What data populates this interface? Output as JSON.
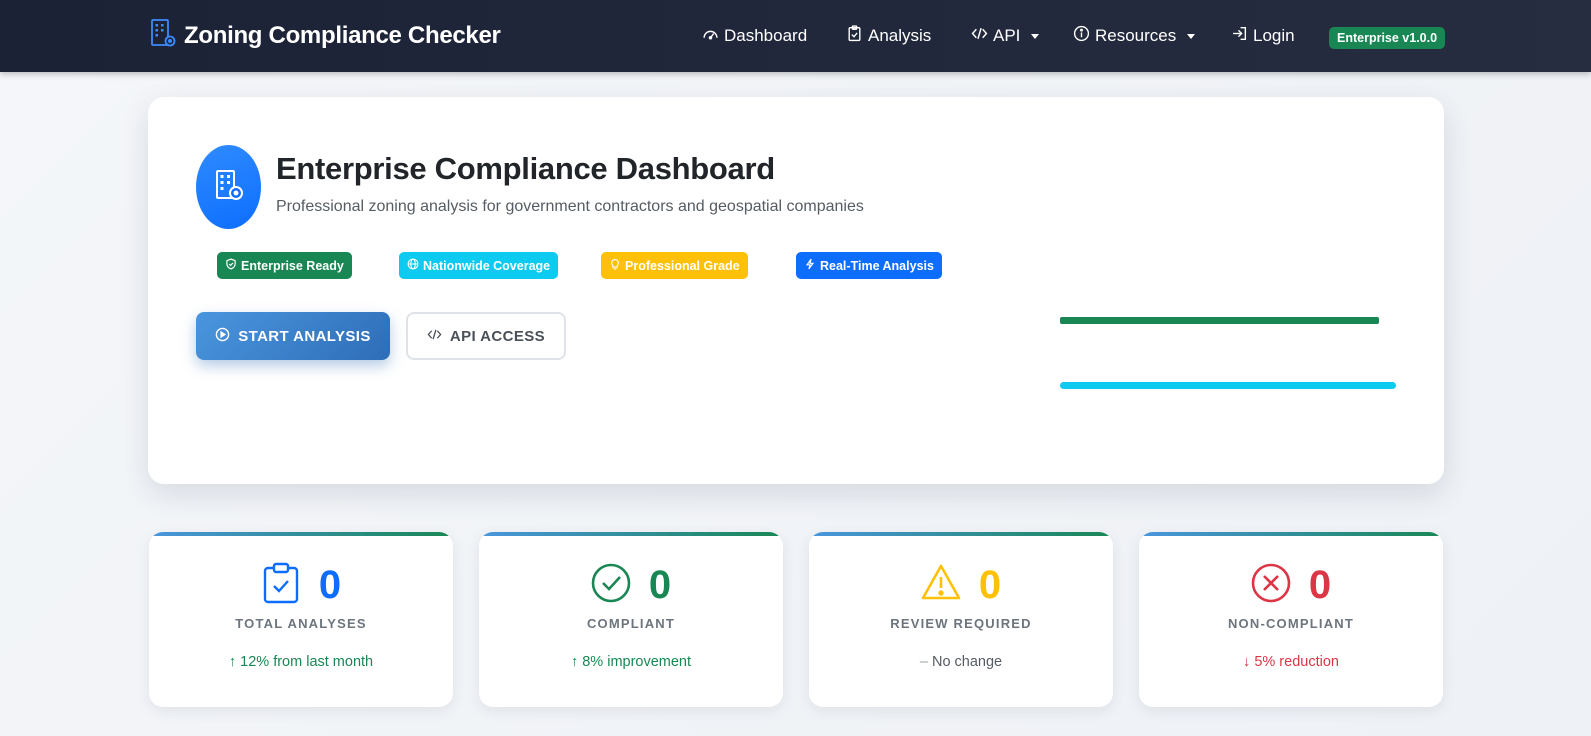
{
  "navbar": {
    "brand": "Zoning Compliance Checker",
    "items": [
      {
        "label": "Dashboard",
        "icon": "speedometer-icon"
      },
      {
        "label": "Analysis",
        "icon": "clipboard-check-icon"
      },
      {
        "label": "API",
        "icon": "code-icon",
        "dropdown": true
      },
      {
        "label": "Resources",
        "icon": "info-circle-icon",
        "dropdown": true
      },
      {
        "label": "Login",
        "icon": "login-icon"
      }
    ],
    "version_badge": "Enterprise v1.0.0"
  },
  "hero": {
    "title": "Enterprise Compliance Dashboard",
    "subtitle": "Professional zoning analysis for government contractors and geospatial companies",
    "features": [
      {
        "label": "Enterprise Ready",
        "color": "#198754",
        "icon": "shield-check-icon"
      },
      {
        "label": "Nationwide Coverage",
        "color": "#0dcaf0",
        "icon": "globe-icon"
      },
      {
        "label": "Professional Grade",
        "color": "#ffc107",
        "icon": "lightbulb-icon"
      },
      {
        "label": "Real-Time Analysis",
        "color": "#0d6efd",
        "icon": "lightning-icon"
      }
    ],
    "primary_button": "START ANALYSIS",
    "secondary_button": "API ACCESS",
    "progress_bars": [
      {
        "color": "#198754",
        "fill": 0.95
      },
      {
        "color": "#0dcaf0",
        "fill": 1.0
      }
    ]
  },
  "stats": [
    {
      "value": "0",
      "label": "TOTAL ANALYSES",
      "trend_symbol": "↑",
      "trend": "12% from last month",
      "value_color": "#0d6efd",
      "trend_color": "#198754",
      "icon": "clipboard-check-icon"
    },
    {
      "value": "0",
      "label": "COMPLIANT",
      "trend_symbol": "↑",
      "trend": "8% improvement",
      "value_color": "#198754",
      "trend_color": "#198754",
      "icon": "check-circle-icon"
    },
    {
      "value": "0",
      "label": "REVIEW REQUIRED",
      "trend_symbol": "–",
      "trend": "No change",
      "value_color": "#ffc107",
      "trend_color": "#555c63",
      "icon": "warning-triangle-icon"
    },
    {
      "value": "0",
      "label": "NON-COMPLIANT",
      "trend_symbol": "↓",
      "trend": "5% reduction",
      "value_color": "#dc3545",
      "trend_color": "#dc3545",
      "icon": "x-circle-icon"
    }
  ]
}
